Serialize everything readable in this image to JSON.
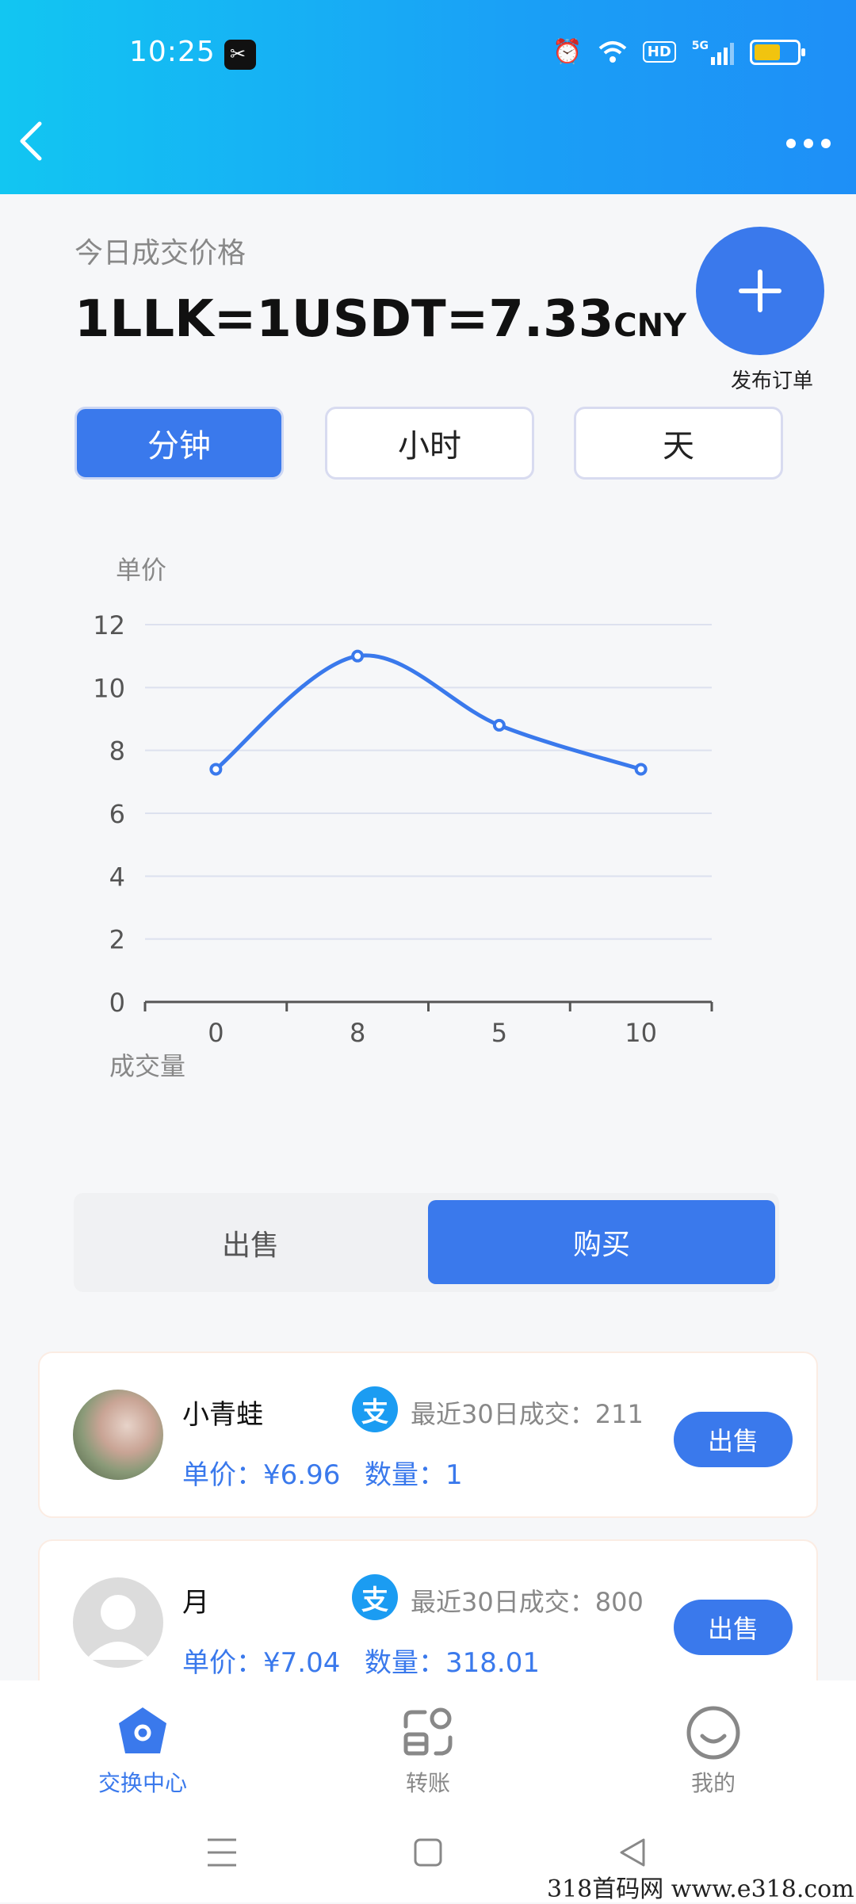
{
  "status_bar": {
    "time": "10:25",
    "hd_label": "HD",
    "network_label": "5G"
  },
  "header": {
    "back_icon": "chevron-left-icon",
    "more_icon": "more-horizontal-icon"
  },
  "price": {
    "label": "今日成交价格",
    "main": "1LLK=1USDT=7.33",
    "unit": "CNY"
  },
  "publish": {
    "icon": "plus-icon",
    "label": "发布订单"
  },
  "range_tabs": [
    {
      "label": "分钟",
      "active": true
    },
    {
      "label": "小时",
      "active": false
    },
    {
      "label": "天",
      "active": false
    }
  ],
  "chart_data": {
    "type": "line",
    "ylabel": "单价",
    "xlabel": "成交量",
    "categories": [
      "0",
      "8",
      "5",
      "10"
    ],
    "values": [
      7.4,
      11,
      8.8,
      7.4
    ],
    "ylim": [
      0,
      12
    ],
    "yticks": [
      0,
      2,
      4,
      6,
      8,
      10,
      12
    ],
    "grid": true,
    "line_color": "#3a79ec"
  },
  "trade_toggle": {
    "sell": "出售",
    "buy": "购买",
    "active": "buy"
  },
  "orders": [
    {
      "name": "小青蛙",
      "recent": "最近30日成交：211",
      "price": "单价：¥6.96",
      "qty": "数量：1",
      "button": "出售",
      "avatar": "photo",
      "pay_icon": "alipay-icon",
      "pay_glyph": "支"
    },
    {
      "name": "月",
      "recent": "最近30日成交：800",
      "price": "单价：¥7.04",
      "qty": "数量：318.01",
      "button": "出售",
      "avatar": "default",
      "pay_icon": "alipay-icon",
      "pay_glyph": "支"
    }
  ],
  "tabbar": [
    {
      "label": "交换中心",
      "icon": "exchange-home-icon",
      "active": true
    },
    {
      "label": "转账",
      "icon": "transfer-icon",
      "active": false
    },
    {
      "label": "我的",
      "icon": "smile-profile-icon",
      "active": false
    }
  ],
  "watermark": "318首码网  www.e318.com"
}
